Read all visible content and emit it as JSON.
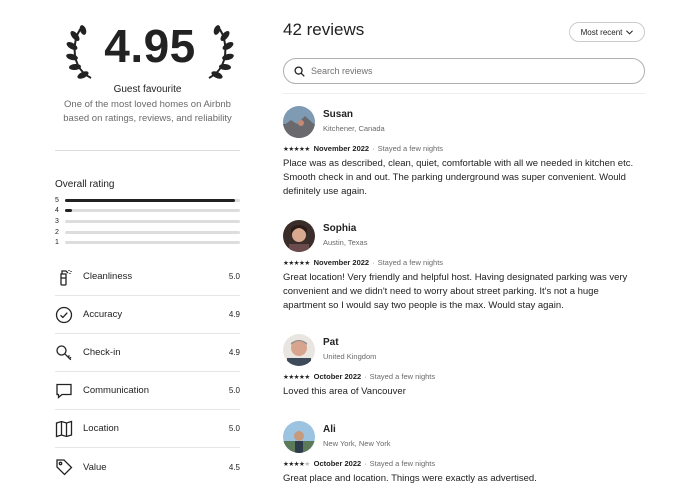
{
  "rating": {
    "score": "4.95",
    "badge": "Guest favourite",
    "description": "One of the most loved homes on Airbnb based on ratings, reviews, and reliability"
  },
  "overall": {
    "title": "Overall rating",
    "bars": [
      {
        "label": "5",
        "fraction": 0.97
      },
      {
        "label": "4",
        "fraction": 0.04
      },
      {
        "label": "3",
        "fraction": 0
      },
      {
        "label": "2",
        "fraction": 0
      },
      {
        "label": "1",
        "fraction": 0
      }
    ]
  },
  "categories": [
    {
      "label": "Cleanliness",
      "value": "5.0",
      "icon": "spray-bottle-icon"
    },
    {
      "label": "Accuracy",
      "value": "4.9",
      "icon": "check-circle-icon"
    },
    {
      "label": "Check-in",
      "value": "4.9",
      "icon": "key-icon"
    },
    {
      "label": "Communication",
      "value": "5.0",
      "icon": "speech-bubble-icon"
    },
    {
      "label": "Location",
      "value": "5.0",
      "icon": "map-icon"
    },
    {
      "label": "Value",
      "value": "4.5",
      "icon": "tag-icon"
    }
  ],
  "reviews_header": {
    "title": "42 reviews",
    "sort_label": "Most recent",
    "search_placeholder": "Search reviews"
  },
  "reviews": [
    {
      "name": "Susan",
      "location": "Kitchener, Canada",
      "stars": 5,
      "date": "November 2022",
      "stay": "Stayed a few nights",
      "text": "Place was as described, clean, quiet, comfortable with all we needed in kitchen etc. Smooth check in and out. The parking underground was super convenient. Would definitely use again."
    },
    {
      "name": "Sophia",
      "location": "Austin, Texas",
      "stars": 5,
      "date": "November 2022",
      "stay": "Stayed a few nights",
      "text": "Great location! Very friendly and helpful host. Having designated parking was very convenient and we didn't need to worry about street parking. It's not a huge apartment so I would say two people is the max. Would stay again."
    },
    {
      "name": "Pat",
      "location": "United Kingdom",
      "stars": 5,
      "date": "October 2022",
      "stay": "Stayed a few nights",
      "text": "Loved this area of Vancouver"
    },
    {
      "name": "Ali",
      "location": "New York, New York",
      "stars": 4,
      "date": "October 2022",
      "stay": "Stayed a few nights",
      "text": "Great place and location. Things were exactly as advertised."
    }
  ],
  "colors": {
    "text": "#222222",
    "muted": "#6a6a6a",
    "divider": "#dddddd",
    "bar_fill": "#222222"
  }
}
